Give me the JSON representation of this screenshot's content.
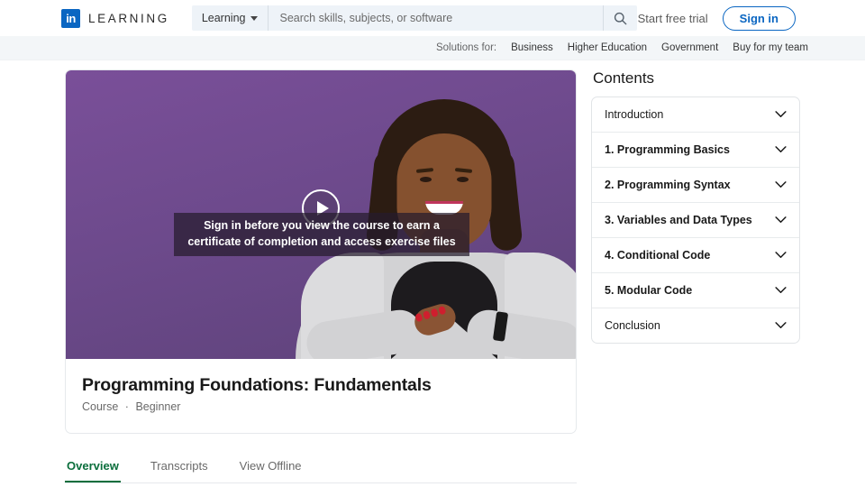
{
  "header": {
    "logo_mark": "in",
    "logo_word": "LEARNING",
    "search_scope": "Learning",
    "search_placeholder": "Search skills, subjects, or software",
    "search_value": "",
    "search_icon": "search-icon",
    "free_trial": "Start free trial",
    "sign_in": "Sign in",
    "accent_blue": "#0a66c2"
  },
  "solutions_bar": {
    "label": "Solutions for:",
    "links": [
      "Business",
      "Higher Education",
      "Government",
      "Buy for my team"
    ]
  },
  "video": {
    "play_icon": "play-icon",
    "caption": "Sign in before you view the course to earn a certificate of completion and access exercise files",
    "background_color": "#6d4a8c"
  },
  "course": {
    "title": "Programming Foundations: Fundamentals",
    "type": "Course",
    "separator": "·",
    "level": "Beginner"
  },
  "tabs": [
    {
      "label": "Overview",
      "active": true
    },
    {
      "label": "Transcripts",
      "active": false
    },
    {
      "label": "View Offline",
      "active": false
    }
  ],
  "tab_active_color": "#0b6e3c",
  "contents": {
    "title": "Contents",
    "chapters": [
      {
        "label": "Introduction",
        "numbered": false
      },
      {
        "label": "1. Programming Basics",
        "numbered": true
      },
      {
        "label": "2. Programming Syntax",
        "numbered": true
      },
      {
        "label": "3. Variables and Data Types",
        "numbered": true
      },
      {
        "label": "4. Conditional Code",
        "numbered": true
      },
      {
        "label": "5. Modular Code",
        "numbered": true
      },
      {
        "label": "Conclusion",
        "numbered": false
      }
    ]
  }
}
